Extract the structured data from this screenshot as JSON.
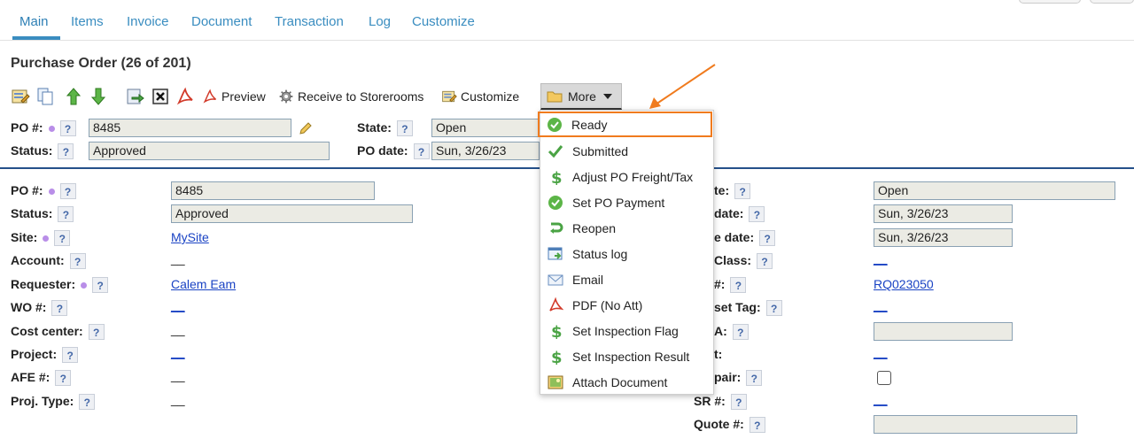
{
  "tabs": [
    {
      "label": "Main"
    },
    {
      "label": "Items"
    },
    {
      "label": "Invoice"
    },
    {
      "label": "Document"
    },
    {
      "label": "Transaction"
    },
    {
      "label": "Log"
    },
    {
      "label": "Customize"
    }
  ],
  "page_title": "Purchase Order (26 of 201)",
  "toolbar": {
    "preview": "Preview",
    "receive": "Receive to Storerooms",
    "customize": "Customize",
    "more": "More"
  },
  "header_form": {
    "po_label": "PO #:",
    "po_value": "8485",
    "status_label": "Status:",
    "status_value": "Approved",
    "state_label": "State:",
    "state_value": "Open",
    "po_date_label": "PO date:",
    "po_date_value": "Sun, 3/26/23"
  },
  "left_form": {
    "po_label": "PO #:",
    "po_value": "8485",
    "status_label": "Status:",
    "status_value": "Approved",
    "site_label": "Site:",
    "site_value": "MySite",
    "account_label": "Account:",
    "account_value": "__",
    "requester_label": "Requester:",
    "requester_value": "Calem Eam",
    "wo_label": "WO #:",
    "wo_value": "__",
    "cost_center_label": "Cost center:",
    "cost_center_value": "__",
    "project_label": "Project:",
    "project_value": "__",
    "afe_label": "AFE #:",
    "afe_value": "__",
    "proj_type_label": "Proj. Type:",
    "proj_type_value": "__"
  },
  "right_form": {
    "state_label": "te:",
    "state_value": "Open",
    "date1_label": "date:",
    "date1_value": "Sun, 3/26/23",
    "date2_label": "e date:",
    "date2_value": "Sun, 3/26/23",
    "class_label": "Class:",
    "class_value": "__",
    "rq_label": "#:",
    "rq_value": "RQ023050",
    "asset_tag_label": "set Tag:",
    "asset_tag_value": "__",
    "a_label": "A:",
    "t_label": "t:",
    "t_value": "__",
    "repair_label": "pair:",
    "sr_label": "SR #:",
    "sr_value": "__",
    "quote_label": "Quote #:"
  },
  "menu": {
    "items": [
      {
        "label": "Ready",
        "icon": "green-check-circle-icon"
      },
      {
        "label": "Submitted",
        "icon": "green-checkmark-icon"
      },
      {
        "label": "Adjust PO Freight/Tax",
        "icon": "dollar-icon"
      },
      {
        "label": "Set PO Payment",
        "icon": "green-check-circle-icon"
      },
      {
        "label": "Reopen",
        "icon": "reopen-arrow-icon"
      },
      {
        "label": "Status log",
        "icon": "log-window-icon"
      },
      {
        "label": "Email",
        "icon": "envelope-icon"
      },
      {
        "label": "PDF (No Att)",
        "icon": "pdf-icon"
      },
      {
        "label": "Set Inspection Flag",
        "icon": "dollar-icon"
      },
      {
        "label": "Set Inspection Result",
        "icon": "dollar-icon"
      },
      {
        "label": "Attach Document",
        "icon": "image-attach-icon"
      }
    ]
  },
  "colors": {
    "tab_blue": "#3a8dc0",
    "link_blue": "#1a43c4",
    "highlight_orange": "#f07b1e",
    "divider_navy": "#25508a"
  }
}
